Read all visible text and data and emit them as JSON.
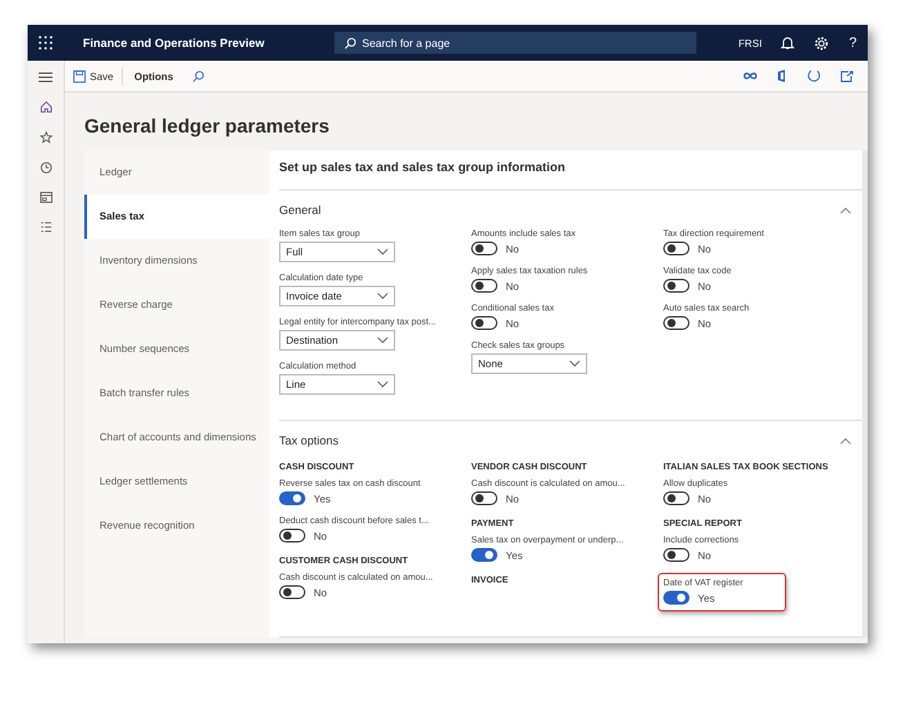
{
  "app_bar": {
    "title": "Finance and Operations Preview",
    "search": {
      "placeholder": "Search for a page"
    },
    "company": "FRSI",
    "help": "?"
  },
  "toolbar": {
    "save": "Save",
    "options": "Options"
  },
  "page_title": "General ledger parameters",
  "nav": [
    {
      "label": "Ledger",
      "selected": false
    },
    {
      "label": "Sales tax",
      "selected": true
    },
    {
      "label": "Inventory dimensions",
      "selected": false
    },
    {
      "label": "Reverse charge",
      "selected": false
    },
    {
      "label": "Number sequences",
      "selected": false
    },
    {
      "label": "Batch transfer rules",
      "selected": false
    },
    {
      "label": "Chart of accounts and dimensions",
      "selected": false
    },
    {
      "label": "Ledger settlements",
      "selected": false
    },
    {
      "label": "Revenue recognition",
      "selected": false
    }
  ],
  "content_title": "Set up sales tax and sales tax group information",
  "sections": [
    {
      "title": "General",
      "expanded": true,
      "columns": [
        [
          {
            "kind": "dropdown",
            "label": "Item sales tax group",
            "value": "Full"
          },
          {
            "kind": "dropdown",
            "label": "Calculation date type",
            "value": "Invoice date"
          },
          {
            "kind": "dropdown",
            "label": "Legal entity for intercompany tax post...",
            "value": "Destination"
          },
          {
            "kind": "dropdown",
            "label": "Calculation method",
            "value": "Line"
          }
        ],
        [
          {
            "kind": "toggle",
            "label": "Amounts include sales tax",
            "on": false,
            "value": "No"
          },
          {
            "kind": "toggle",
            "label": "Apply sales tax taxation rules",
            "on": false,
            "value": "No"
          },
          {
            "kind": "toggle",
            "label": "Conditional sales tax",
            "on": false,
            "value": "No"
          },
          {
            "kind": "dropdown",
            "label": "Check sales tax groups",
            "value": "None"
          }
        ],
        [
          {
            "kind": "toggle",
            "label": "Tax direction requirement",
            "on": false,
            "value": "No"
          },
          {
            "kind": "toggle",
            "label": "Validate tax code",
            "on": false,
            "value": "No"
          },
          {
            "kind": "toggle",
            "label": "Auto sales tax search",
            "on": false,
            "value": "No"
          }
        ]
      ]
    },
    {
      "title": "Tax options",
      "expanded": true,
      "columns": [
        [
          {
            "kind": "heading",
            "label": "CASH DISCOUNT"
          },
          {
            "kind": "toggle",
            "label": "Reverse sales tax on cash discount",
            "on": true,
            "value": "Yes"
          },
          {
            "kind": "toggle",
            "label": "Deduct cash discount before sales t...",
            "on": false,
            "value": "No"
          },
          {
            "kind": "heading",
            "label": "CUSTOMER CASH DISCOUNT"
          },
          {
            "kind": "toggle",
            "label": "Cash discount is calculated on amou...",
            "on": false,
            "value": "No"
          }
        ],
        [
          {
            "kind": "heading",
            "label": "VENDOR CASH DISCOUNT"
          },
          {
            "kind": "toggle",
            "label": "Cash discount is calculated on amou...",
            "on": false,
            "value": "No"
          },
          {
            "kind": "heading",
            "label": "PAYMENT"
          },
          {
            "kind": "toggle",
            "label": "Sales tax on overpayment or underp...",
            "on": true,
            "value": "Yes"
          },
          {
            "kind": "heading",
            "label": "INVOICE"
          }
        ],
        [
          {
            "kind": "heading",
            "label": "ITALIAN SALES TAX BOOK SECTIONS"
          },
          {
            "kind": "toggle",
            "label": "Allow duplicates",
            "on": false,
            "value": "No"
          },
          {
            "kind": "heading",
            "label": "SPECIAL REPORT"
          },
          {
            "kind": "toggle",
            "label": "Include corrections",
            "on": false,
            "value": "No"
          },
          {
            "kind": "toggle",
            "label": "Date of VAT register",
            "on": true,
            "value": "Yes",
            "highlighted": true
          }
        ]
      ]
    }
  ]
}
